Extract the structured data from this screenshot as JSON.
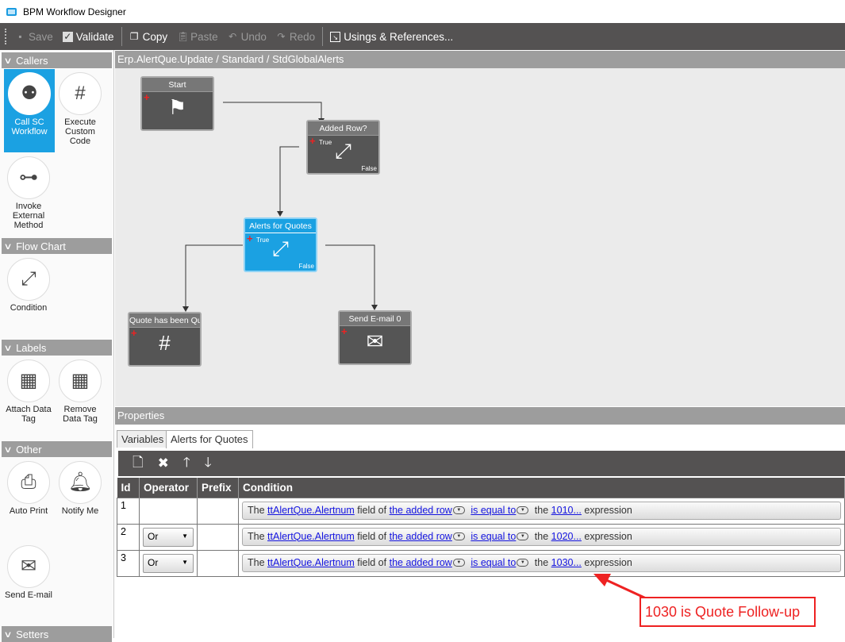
{
  "window": {
    "title": "BPM Workflow Designer"
  },
  "toolbar": {
    "save": "Save",
    "validate": "Validate",
    "copy": "Copy",
    "paste": "Paste",
    "undo": "Undo",
    "redo": "Redo",
    "usings": "Usings & References..."
  },
  "palette": {
    "sections": [
      {
        "label": "Callers"
      },
      {
        "label": "Flow Chart"
      },
      {
        "label": "Labels"
      },
      {
        "label": "Other"
      },
      {
        "label": "Setters"
      }
    ],
    "tools": [
      {
        "label": "Call SC Workflow",
        "selected": true
      },
      {
        "label": "Execute Custom Code"
      },
      {
        "label": "Invoke External Method"
      },
      {
        "label": "Condition"
      },
      {
        "label": "Attach Data Tag"
      },
      {
        "label": "Remove Data Tag"
      },
      {
        "label": "Auto Print"
      },
      {
        "label": "Notify Me"
      },
      {
        "label": "Send E-mail"
      }
    ]
  },
  "canvas": {
    "breadcrumb": "Erp.AlertQue.Update / Standard / StdGlobalAlerts",
    "nodes": [
      {
        "title": "Start"
      },
      {
        "title": "Added Row?",
        "true_label": "True",
        "false_label": "False"
      },
      {
        "title": "Alerts for Quotes",
        "true_label": "True",
        "false_label": "False"
      },
      {
        "title": "Quote has been Qu"
      },
      {
        "title": "Send E-mail 0"
      }
    ]
  },
  "properties": {
    "title": "Properties",
    "tabs": [
      {
        "label": "Variables"
      },
      {
        "label": "Alerts for Quotes",
        "active": true
      }
    ],
    "columns": [
      "Id",
      "Operator",
      "Prefix",
      "Condition"
    ],
    "rows": [
      {
        "id": "1",
        "operator": "",
        "prefix": "",
        "the": "The",
        "field": "ttAlertQue.Alertnum",
        "field_of": "field of",
        "row": "the added row",
        "op": "is equal to",
        "the2": "the",
        "value": "1010...",
        "tail": "expression"
      },
      {
        "id": "2",
        "operator": "Or",
        "prefix": "",
        "the": "The",
        "field": "ttAlertQue.Alertnum",
        "field_of": "field of",
        "row": "the added row",
        "op": "is equal to",
        "the2": "the",
        "value": "1020...",
        "tail": "expression"
      },
      {
        "id": "3",
        "operator": "Or",
        "prefix": "",
        "the": "The",
        "field": "ttAlertQue.Alertnum",
        "field_of": "field of",
        "row": "the added row",
        "op": "is equal to",
        "the2": "the",
        "value": "1030...",
        "tail": "expression"
      }
    ]
  },
  "annotation": {
    "text": "1030 is Quote Follow-up",
    "color": "#e22222"
  }
}
